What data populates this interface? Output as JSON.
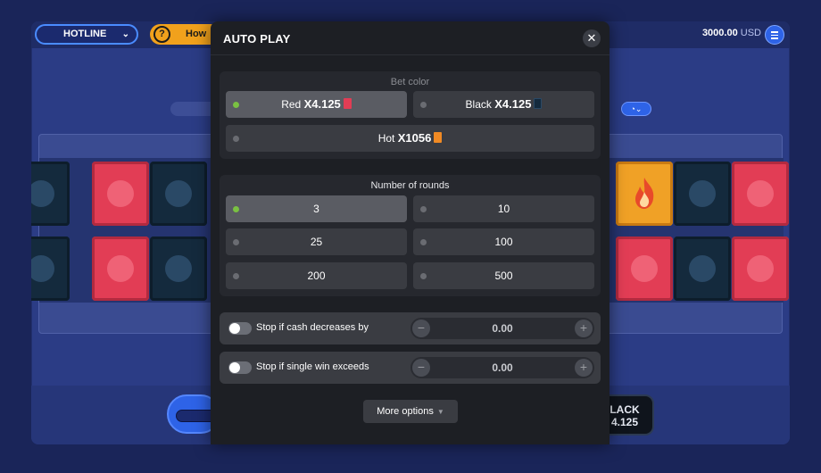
{
  "topbar": {
    "game_name": "HOTLINE",
    "how_to_label": "How",
    "balance_value": "3000.00",
    "balance_currency": "USD"
  },
  "board": {
    "black_button_line1": "LACK",
    "black_button_line2": "4.125"
  },
  "modal": {
    "title": "AUTO PLAY",
    "bet_color": {
      "title": "Bet color",
      "options": [
        {
          "label": "Red",
          "mult": "X4.125",
          "color": "#e23d55",
          "selected": true
        },
        {
          "label": "Black",
          "mult": "X4.125",
          "color": "#142a3d",
          "selected": false
        },
        {
          "label": "Hot",
          "mult": "X1056",
          "color": "#f08a24",
          "selected": false
        }
      ]
    },
    "rounds": {
      "title": "Number of rounds",
      "options": [
        {
          "label": "3",
          "selected": true
        },
        {
          "label": "10",
          "selected": false
        },
        {
          "label": "25",
          "selected": false
        },
        {
          "label": "100",
          "selected": false
        },
        {
          "label": "200",
          "selected": false
        },
        {
          "label": "500",
          "selected": false
        }
      ]
    },
    "stop_decrease": {
      "label": "Stop if cash decreases by",
      "value": "0.00",
      "minus": "−",
      "plus": "+"
    },
    "stop_win": {
      "label": "Stop if single win exceeds",
      "value": "0.00",
      "minus": "−",
      "plus": "+"
    },
    "more_options": "More options"
  },
  "colors": {
    "red": "#e23d55",
    "black": "#142a3d",
    "hot": "#f0a126",
    "accent_blue": "#2e63e7",
    "selected_led": "#7ac142"
  }
}
